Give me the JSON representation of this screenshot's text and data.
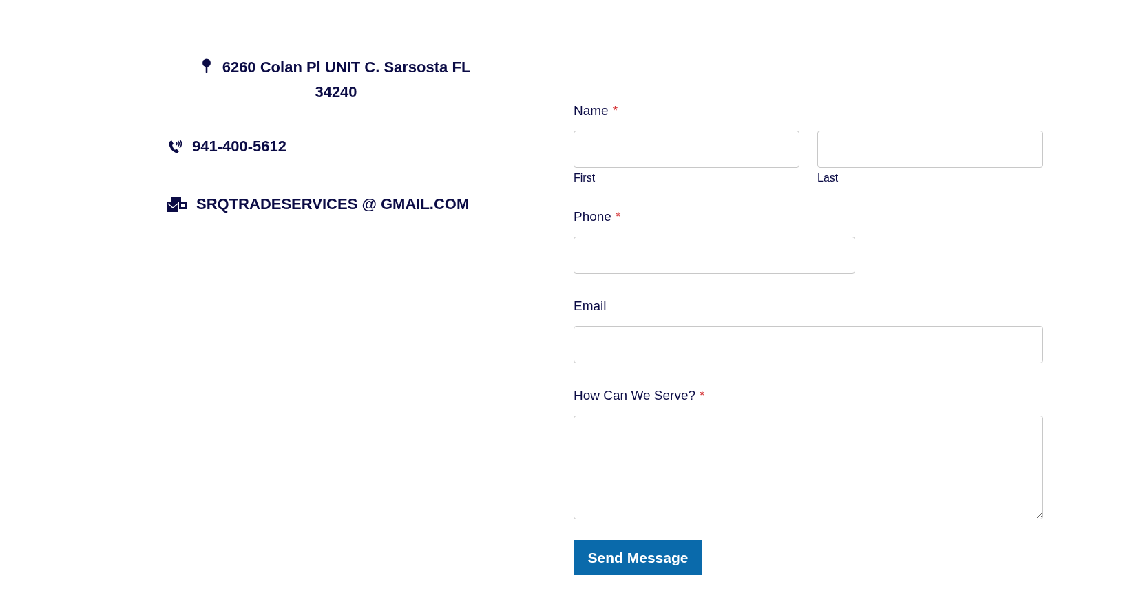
{
  "contact": [
    {
      "kind": "address",
      "text": "6260 Colan Pl UNIT C. Sarsosta FL 34240"
    },
    {
      "kind": "phone",
      "text": "941-400-5612"
    },
    {
      "kind": "email",
      "text": "SRQTRADESERVICES @ GMAIL.COM"
    }
  ],
  "form": {
    "fields": [
      {
        "kind": "split",
        "label": "Name",
        "required_mark": "*",
        "parts": [
          {
            "sublabel": "First"
          },
          {
            "sublabel": "Last"
          }
        ]
      },
      {
        "kind": "short",
        "label": "Phone",
        "required_mark": "*"
      },
      {
        "kind": "long",
        "label": "Email"
      },
      {
        "kind": "textarea",
        "label": "How Can We Serve?",
        "required_mark": "*"
      }
    ],
    "submit": "Send Message"
  }
}
